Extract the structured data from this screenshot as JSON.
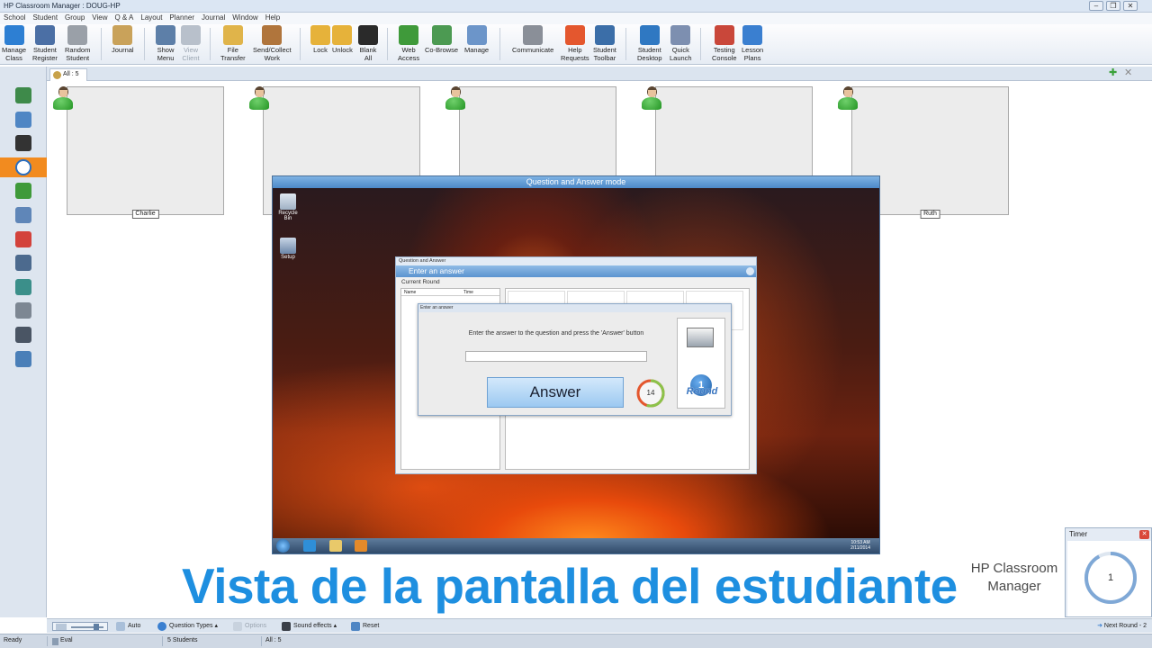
{
  "window": {
    "title": "HP Classroom Manager : DOUG-HP",
    "minimize": "‒",
    "restore": "❐",
    "close": "✕"
  },
  "menu": [
    "School",
    "Student",
    "Group",
    "View",
    "Q & A",
    "Layout",
    "Planner",
    "Journal",
    "Window",
    "Help"
  ],
  "toolbar": [
    {
      "label": "Manage\nClass",
      "icon": "manage-class-icon",
      "color": "#2d7fd3"
    },
    {
      "label": "Student\nRegister",
      "icon": "register-icon",
      "color": "#4b6fa5"
    },
    {
      "label": "Random\nStudent",
      "icon": "dice-icon",
      "color": "#9aa0a8"
    },
    {
      "label": "Journal",
      "icon": "journal-icon",
      "color": "#c9a25a"
    },
    {
      "label": "Show\nMenu",
      "icon": "show-menu-icon",
      "color": "#5d7fa8"
    },
    {
      "label": "View\nClient",
      "icon": "view-client-icon",
      "color": "#b8c0cb"
    },
    {
      "label": "File\nTransfer",
      "icon": "folder-icon",
      "color": "#e0b44a"
    },
    {
      "label": "Send/Collect\nWork",
      "icon": "briefcase-icon",
      "color": "#b0753c"
    },
    {
      "label": "Lock",
      "icon": "lock-icon",
      "color": "#e6b23a"
    },
    {
      "label": "Unlock",
      "icon": "unlock-icon",
      "color": "#e6b23a"
    },
    {
      "label": "Blank\nAll",
      "icon": "monitor-icon",
      "color": "#2a2a2a"
    },
    {
      "label": "Web\nAccess",
      "icon": "globe-icon",
      "color": "#3f9a3a"
    },
    {
      "label": "Co-Browse",
      "icon": "cobrowse-icon",
      "color": "#4c9a52"
    },
    {
      "label": "Manage",
      "icon": "manage-icon",
      "color": "#6c95c9"
    },
    {
      "label": "Communicate",
      "icon": "communicate-icon",
      "color": "#8a8f98"
    },
    {
      "label": "Help\nRequests",
      "icon": "lifebuoy-icon",
      "color": "#e4572e"
    },
    {
      "label": "Student\nToolbar",
      "icon": "student-toolbar-icon",
      "color": "#3b6ea8"
    },
    {
      "label": "Student\nDesktop",
      "icon": "student-desktop-icon",
      "color": "#2f78c2"
    },
    {
      "label": "Quick\nLaunch",
      "icon": "rocket-icon",
      "color": "#7d8fb0"
    },
    {
      "label": "Testing\nConsole",
      "icon": "testing-console-icon",
      "color": "#c9473a"
    },
    {
      "label": "Lesson\nPlans",
      "icon": "puzzle-icon",
      "color": "#3a7fd0"
    }
  ],
  "tabs": {
    "all_label": "All : 5",
    "add": "✚",
    "close": "✕"
  },
  "sidebar": [
    {
      "name": "home-icon",
      "color": "#3e8a4a"
    },
    {
      "name": "grid-view-icon",
      "color": "#4f86c4"
    },
    {
      "name": "headphones-icon",
      "color": "#333333"
    },
    {
      "name": "question-icon",
      "color": "#ffffff",
      "active": true
    },
    {
      "name": "globe-icon",
      "color": "#3f9a3a"
    },
    {
      "name": "window-icon",
      "color": "#5f86b8"
    },
    {
      "name": "pie-chart-icon",
      "color": "#d3423b"
    },
    {
      "name": "printer-icon",
      "color": "#4c6a8e"
    },
    {
      "name": "users-icon",
      "color": "#3b8f8a"
    },
    {
      "name": "disc-icon",
      "color": "#7d8793"
    },
    {
      "name": "keyboard-icon",
      "color": "#4a5564"
    },
    {
      "name": "chart-icon",
      "color": "#4a7fb8"
    }
  ],
  "students": [
    "Charlie",
    "",
    "",
    "",
    "Ruth"
  ],
  "student_screen": {
    "header": "Question and Answer mode",
    "recycle_bin": "Recycle Bin",
    "setup": "Setup",
    "clock_time": "10:53 AM",
    "clock_date": "2/11/2014"
  },
  "qa_window": {
    "title": "Question and Answer",
    "subtitle": "Enter an answer",
    "current_round": "Current Round",
    "col_name": "Name",
    "col_time": "Time"
  },
  "answer_dialog": {
    "title": "Enter an answer",
    "prompt": "Enter the answer to the question and press the 'Answer' button",
    "input_value": "",
    "button": "Answer",
    "countdown": "14",
    "countdown_fraction": 0.55,
    "round_number": "1",
    "round_label": "Round"
  },
  "caption": "Vista de la pantalla del estudiante",
  "brand": "HP Classroom Manager",
  "timer": {
    "title": "Timer",
    "value": "1",
    "fraction": 0.92
  },
  "bottom_toolbar": {
    "auto": "Auto",
    "question_types": "Question Types",
    "options": "Options",
    "sound_effects": "Sound effects",
    "reset": "Reset",
    "next_round": "Next Round - 2"
  },
  "status": {
    "ready": "Ready",
    "eval": "Eval",
    "students": "5 Students",
    "all": "All : 5"
  }
}
